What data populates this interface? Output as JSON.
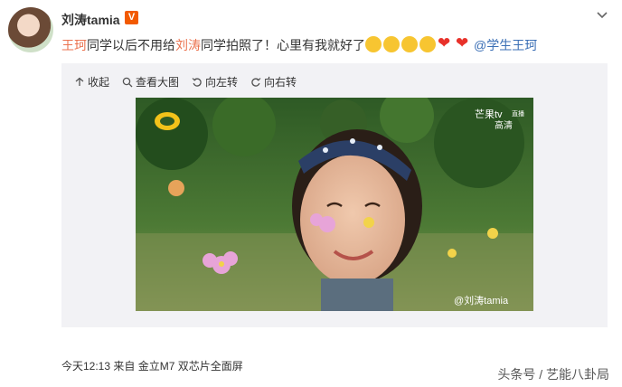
{
  "post": {
    "author": "刘涛tamia",
    "verified_badge": "V",
    "text_parts": {
      "m1": "王珂",
      "t1": "同学以后不用给",
      "m2": "刘涛",
      "t2": "同学拍照了！心里有我就好了",
      "link": "@学生王珂"
    },
    "emojis": [
      "cry-laugh-icon",
      "cry-laugh-icon",
      "smile-icon",
      "blush-icon",
      "heart-icon",
      "heart-icon"
    ]
  },
  "toolbar": {
    "collapse": "收起",
    "view_large": "查看大图",
    "rotate_left": "向左转",
    "rotate_right": "向右转"
  },
  "photo": {
    "tv_logo": "芒果tv",
    "tv_sub": "直播",
    "tv_hd": "高清",
    "watermark": "@刘涛tamia"
  },
  "footer": {
    "time_source": "今天12:13 来自 金立M7 双芯片全面屏"
  },
  "corner_watermark": "头条号 / 艺能八卦局",
  "colors": {
    "mention": "#eb7350",
    "link": "#3b6fb5",
    "badge": "#f25a00"
  }
}
